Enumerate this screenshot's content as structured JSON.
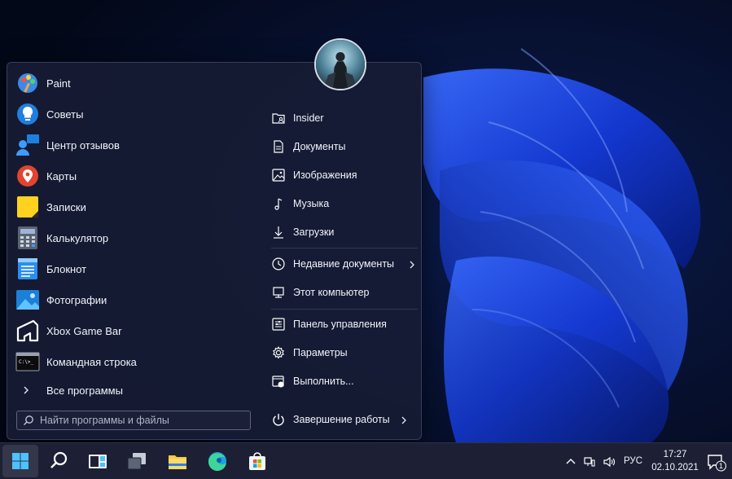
{
  "start_menu": {
    "apps": [
      {
        "label": "Paint",
        "icon": "paint-icon"
      },
      {
        "label": "Советы",
        "icon": "tips-icon"
      },
      {
        "label": "Центр отзывов",
        "icon": "feedback-hub-icon"
      },
      {
        "label": "Карты",
        "icon": "maps-icon"
      },
      {
        "label": "Записки",
        "icon": "sticky-notes-icon"
      },
      {
        "label": "Калькулятор",
        "icon": "calculator-icon"
      },
      {
        "label": "Блокнот",
        "icon": "notepad-icon"
      },
      {
        "label": "Фотографии",
        "icon": "photos-icon"
      },
      {
        "label": "Xbox Game Bar",
        "icon": "xbox-game-bar-icon"
      },
      {
        "label": "Командная строка",
        "icon": "command-prompt-icon"
      }
    ],
    "all_programs": "Все программы",
    "search": {
      "placeholder": "Найти программы и файлы",
      "value": ""
    },
    "places": [
      {
        "label": "Insider",
        "icon": "folder-user-icon"
      },
      {
        "label": "Документы",
        "icon": "document-icon"
      },
      {
        "label": "Изображения",
        "icon": "image-icon"
      },
      {
        "label": "Музыка",
        "icon": "music-icon"
      },
      {
        "label": "Загрузки",
        "icon": "download-icon"
      },
      {
        "label": "Недавние документы",
        "icon": "clock-icon"
      },
      {
        "label": "Этот компьютер",
        "icon": "computer-icon"
      },
      {
        "label": "Панель управления",
        "icon": "control-panel-icon"
      },
      {
        "label": "Параметры",
        "icon": "gear-icon"
      },
      {
        "label": "Выполнить...",
        "icon": "run-icon"
      }
    ],
    "shutdown": "Завершение работы"
  },
  "taskbar": {
    "apps": [
      "start-icon",
      "search-icon",
      "task-view-icon",
      "widgets-icon",
      "file-explorer-icon",
      "edge-icon",
      "store-icon"
    ],
    "language": "РУС",
    "time": "17:27",
    "date": "02.10.2021",
    "notifications": "1"
  },
  "colors": {
    "accent": "#1a5cff",
    "menu_bg": "#161c34",
    "taskbar_bg": "#1d2035"
  }
}
